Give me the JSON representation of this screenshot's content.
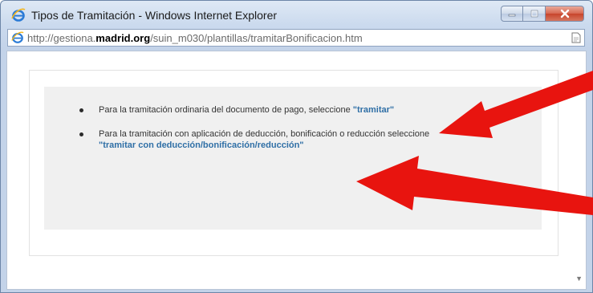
{
  "window": {
    "title": "Tipos de Tramitación - Windows Internet Explorer",
    "buttons": {
      "minimize": "minimize-icon",
      "maximize": "maximize-icon",
      "close": "close-icon"
    }
  },
  "address": {
    "url_prefix": "http://gestiona.",
    "url_domain": "madrid.org",
    "url_path": "/suin_m030/plantillas/tramitarBonificacion.htm"
  },
  "content": {
    "items": [
      {
        "text": "Para la tramitación ordinaria del documento de pago, seleccione ",
        "link": "\"tramitar\""
      },
      {
        "text": "Para la tramitación con aplicación de deducción, bonificación o reducción seleccione ",
        "link": "\"tramitar con deducción/bonificación/reducción\""
      }
    ]
  },
  "annotations": {
    "arrow_color": "#e8140f",
    "count": 2
  },
  "colors": {
    "link": "#2f6fa6",
    "panel": "#f0f0f0",
    "close_button": "#c7442b"
  }
}
